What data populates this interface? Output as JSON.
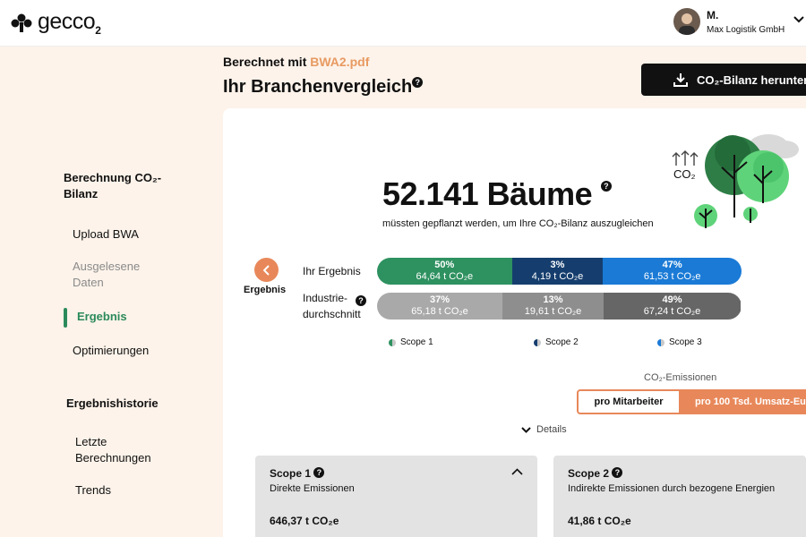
{
  "app": {
    "logo_text": "gecco",
    "logo_sub": "2"
  },
  "user": {
    "name": "M.",
    "company": "Max Logistik GmbH"
  },
  "sidebar": {
    "section1_title": "Berechnung CO₂-Bilanz",
    "items": [
      {
        "label": "Upload BWA"
      },
      {
        "label": "Ausgelesene Daten"
      },
      {
        "label": "Ergebnis"
      },
      {
        "label": "Optimierungen"
      }
    ],
    "section2_title": "Ergebnishistorie",
    "history": [
      {
        "label": "Letzte Berechnungen"
      },
      {
        "label": "Trends"
      }
    ]
  },
  "header": {
    "computed_with": "Berechnet mit",
    "file": "BWA2.pdf",
    "title": "Ihr Branchenvergleich",
    "help": "?",
    "download_label": "CO₂-Bilanz herunterl"
  },
  "trees": {
    "count": "52.141 Bäume",
    "help": "?",
    "subtitle": "müssten gepflanzt werden, um Ihre CO₂-Bilanz auszugleichen",
    "illustration_label": "CO₂"
  },
  "result": {
    "back_label": "Ergebnis",
    "rows": [
      {
        "label": "Ihr Ergebnis",
        "segments": [
          {
            "pct": "50%",
            "value": "64,64 t CO₂e",
            "share": 0.37,
            "color": "#2e9160"
          },
          {
            "pct": "3%",
            "value": "4,19 t CO₂e",
            "share": 0.25,
            "color": "#153e6e"
          },
          {
            "pct": "47%",
            "value": "61,53 t CO₂e",
            "share": 0.38,
            "color": "#1a7ad6"
          }
        ]
      },
      {
        "label": "Industrie-durchschnitt",
        "help": "?",
        "segments": [
          {
            "pct": "37%",
            "value": "65,18 t CO₂e",
            "share": 0.345,
            "color": "#a9a9a9"
          },
          {
            "pct": "13%",
            "value": "19,61 t CO₂e",
            "share": 0.278,
            "color": "#8e8e8e"
          },
          {
            "pct": "49%",
            "value": "67,24 t CO₂e",
            "share": 0.377,
            "color": "#666666"
          }
        ]
      }
    ],
    "legend": [
      {
        "label": "Scope 1",
        "color": "#2e9160"
      },
      {
        "label": "Scope 2",
        "color": "#153e6e"
      },
      {
        "label": "Scope 3",
        "color": "#1a7ad6"
      }
    ]
  },
  "emissions": {
    "label": "CO₂-Emissionen",
    "options": [
      {
        "label": "pro Mitarbeiter"
      },
      {
        "label": "pro 100 Tsd. Umsatz-Eu"
      }
    ]
  },
  "details_label": "Details",
  "scopes": [
    {
      "title": "Scope 1",
      "help": "?",
      "desc": "Direkte Emissionen",
      "value": "646,37 t CO₂e"
    },
    {
      "title": "Scope 2",
      "help": "?",
      "desc": "Indirekte Emissionen durch bezogene Energien",
      "value": "41,86 t CO₂e"
    }
  ]
}
